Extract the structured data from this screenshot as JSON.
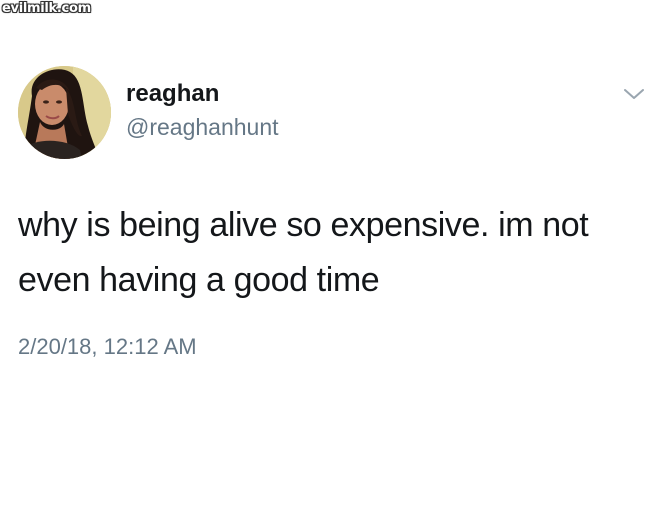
{
  "watermark": {
    "text": "evilmilk.com"
  },
  "tweet": {
    "display_name": "reaghan",
    "handle": "@reaghanhunt",
    "text_line_1": "why is being alive so expensive. im not",
    "text_line_2": "even having a good time",
    "timestamp": "2/20/18, 12:12 AM"
  },
  "icons": {
    "more_options": "chevron-down-icon",
    "avatar": "profile-photo"
  },
  "colors": {
    "primary_text": "#14171a",
    "secondary_text": "#657786",
    "background": "#ffffff"
  }
}
